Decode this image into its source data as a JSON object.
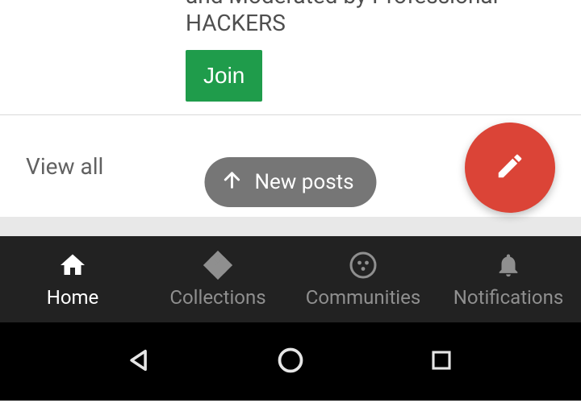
{
  "card": {
    "description_line1": "and Moderated by Professional",
    "description_line2": "HACKERS",
    "join_label": "Join"
  },
  "viewall": {
    "label": "View all"
  },
  "newposts": {
    "label": "New posts"
  },
  "tabs": {
    "home": "Home",
    "collections": "Collections",
    "communities": "Communities",
    "notifications": "Notifications"
  },
  "colors": {
    "accent_green": "#1f9c4b",
    "accent_red": "#db4437"
  }
}
